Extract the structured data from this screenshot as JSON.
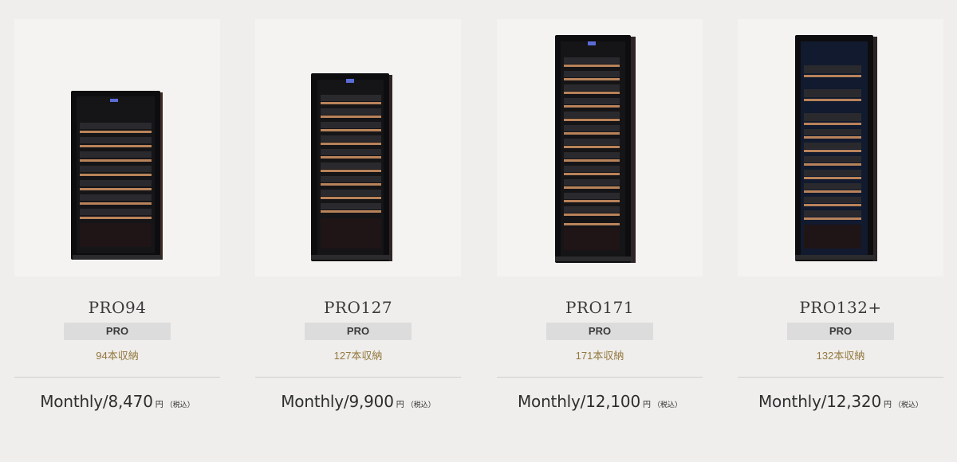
{
  "products": [
    {
      "model": "PRO94",
      "badge": "PRO",
      "capacity": "94本収納",
      "price_prefix": "Monthly/",
      "price_value": "8,470",
      "price_unit": "円",
      "price_tax": "（税込）",
      "image_icon": "wine-cellar-image"
    },
    {
      "model": "PRO127",
      "badge": "PRO",
      "capacity": "127本収納",
      "price_prefix": "Monthly/",
      "price_value": "9,900",
      "price_unit": "円",
      "price_tax": "（税込）",
      "image_icon": "wine-cellar-image"
    },
    {
      "model": "PRO171",
      "badge": "PRO",
      "capacity": "171本収納",
      "price_prefix": "Monthly/",
      "price_value": "12,100",
      "price_unit": "円",
      "price_tax": "（税込）",
      "image_icon": "wine-cellar-image"
    },
    {
      "model": "PRO132+",
      "badge": "PRO",
      "capacity": "132本収納",
      "price_prefix": "Monthly/",
      "price_value": "12,320",
      "price_unit": "円",
      "price_tax": "（税込）",
      "image_icon": "wine-cellar-image"
    }
  ],
  "colors": {
    "background": "#efeeec",
    "image_background": "#f4f3f1",
    "badge_background": "#dcdcdc",
    "capacity_text": "#94783e",
    "shelf_wood": "#b9835a"
  }
}
